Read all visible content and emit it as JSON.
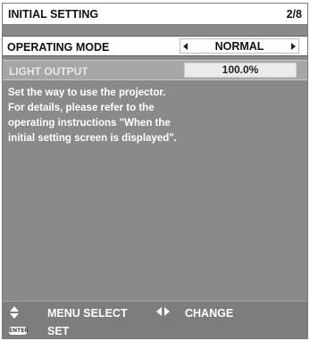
{
  "header": {
    "title": "INITIAL SETTING",
    "page_indicator": "2/8"
  },
  "operating_mode": {
    "label": "OPERATING MODE",
    "value": "NORMAL"
  },
  "light_output": {
    "label": "LIGHT OUTPUT",
    "value": "100.0%"
  },
  "description": {
    "lines": [
      "Set the way to use the projector.",
      "For details, please refer to the",
      "operating instructions \"When the",
      "initial setting screen is displayed\"."
    ]
  },
  "footer": {
    "menu_select_label": "MENU SELECT",
    "change_label": "CHANGE",
    "enter_key_label": "ENTER",
    "set_label": "SET"
  },
  "colors": {
    "panel_background": "#8a8a8a",
    "header_background": "#ffffff",
    "disabled_row": "#a6a6a6",
    "footer_background": "#7d7d7d"
  }
}
